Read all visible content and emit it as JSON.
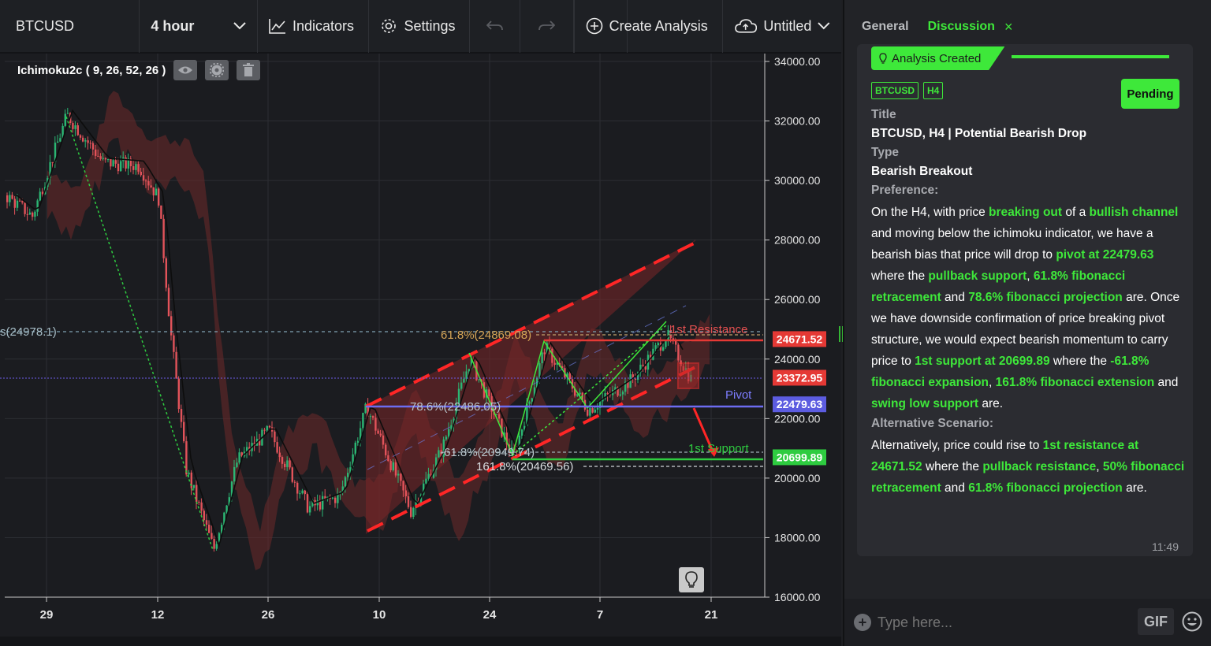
{
  "toolbar": {
    "symbol": "BTCUSD",
    "interval": "4 hour",
    "indicators_label": "Indicators",
    "settings_label": "Settings",
    "create_analysis_label": "Create Analysis",
    "layout_name": "Untitled"
  },
  "chart": {
    "indicator_legend": "Ichimoku2c ( 9, 26, 52, 26 )",
    "price_labels": [
      "34000.00",
      "32000.00",
      "30000.00",
      "28000.00",
      "26000.00",
      "24000.00",
      "22000.00",
      "20000.00",
      "18000.00",
      "16000.00"
    ],
    "date_labels": [
      "29",
      "12",
      "26",
      "10",
      "24",
      "7",
      "21"
    ],
    "badges": [
      {
        "text": "24671.52",
        "color": "#e53935"
      },
      {
        "text": "23372.95",
        "color": "#e53935"
      },
      {
        "text": "22479.63",
        "color": "#5c5ce0"
      },
      {
        "text": "20699.89",
        "color": "#2ecc40"
      }
    ],
    "annotations": {
      "fib_left": "s(24978.1)",
      "fib_618_top": "61.8%(24869.08)",
      "first_resistance": "1st Resistance",
      "pivot": "Pivot",
      "fib_786": "78.6%(22486.05)",
      "fib_618_low": "-61.8%(20949.74)",
      "fib_1618": "161.8%(20469.56)",
      "first_support": "1st Support"
    },
    "colors": {
      "bull": "#2bb673",
      "bear": "#e2535a",
      "cloud": "#6e2a2a",
      "channel": "#ff2020"
    }
  },
  "panel": {
    "tabs": [
      "General",
      "Discussion"
    ],
    "active_tab": "Discussion",
    "card": {
      "created_label": "Analysis Created",
      "tags": [
        "BTCUSD",
        "H4"
      ],
      "status": "Pending",
      "title_label": "Title",
      "title": "BTCUSD, H4 | Potential Bearish Drop",
      "type_label": "Type",
      "type": "Bearish Breakout",
      "preference_label": "Preference:",
      "preference": [
        {
          "t": "On the H4, with price "
        },
        {
          "t": "breaking out",
          "g": true
        },
        {
          "t": " of a "
        },
        {
          "t": "bullish channel",
          "g": true
        },
        {
          "t": " and moving below the ichimoku indicator, we have a bearish bias that price will drop to "
        },
        {
          "t": "pivot at 22479.63",
          "g": true
        },
        {
          "t": " where the "
        },
        {
          "t": "pullback support",
          "g": true
        },
        {
          "t": ", "
        },
        {
          "t": "61.8% fibonacci retracement",
          "g": true
        },
        {
          "t": " and "
        },
        {
          "t": "78.6% fibonacci projection",
          "g": true
        },
        {
          "t": " are. Once we have downside confirmation of price breaking pivot structure, we would expect bearish momentum to carry price to "
        },
        {
          "t": "1st support at 20699.89",
          "g": true
        },
        {
          "t": " where the "
        },
        {
          "t": "-61.8% fibonacci expansion",
          "g": true
        },
        {
          "t": ", "
        },
        {
          "t": "161.8% fibonacci extension",
          "g": true
        },
        {
          "t": " and "
        },
        {
          "t": "swing low support",
          "g": true
        },
        {
          "t": " are."
        }
      ],
      "alternative_label": "Alternative Scenario:",
      "alternative": [
        {
          "t": "Alternatively, price could rise to "
        },
        {
          "t": "1st resistance at 24671.52",
          "g": true
        },
        {
          "t": " where the "
        },
        {
          "t": "pullback resistance",
          "g": true
        },
        {
          "t": ", "
        },
        {
          "t": "50% fibonacci retracement",
          "g": true
        },
        {
          "t": " and "
        },
        {
          "t": "61.8% fibonacci projection",
          "g": true
        },
        {
          "t": " are."
        }
      ],
      "time": "11:49"
    },
    "composer": {
      "placeholder": "Type here...",
      "gif_label": "GIF"
    }
  }
}
